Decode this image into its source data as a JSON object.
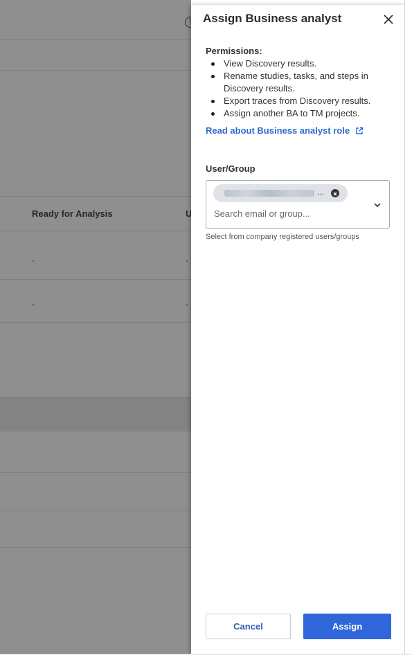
{
  "background": {
    "column_header": "Ready for Analysis",
    "column_header_cut": "U",
    "row_values": [
      "-",
      "-",
      "-",
      "-"
    ],
    "help_icon": "question-circle-icon"
  },
  "drawer": {
    "title": "Assign Business analyst",
    "close_icon": "close-icon",
    "permissions_title": "Permissions:",
    "permissions": [
      "View Discovery results.",
      "Rename studies, tasks, and steps in Discovery results.",
      "Export traces from Discovery results.",
      "Assign another BA to TM projects."
    ],
    "role_link": "Read about Business analyst role",
    "role_link_icon": "external-link-icon",
    "user_group": {
      "label": "User/Group",
      "chip_ellipsis": "...",
      "chip_remove_icon": "close-circle-icon",
      "search_placeholder": "Search email or group...",
      "search_value": "",
      "chevron_icon": "chevron-down-icon",
      "helper": "Select from company registered users/groups"
    },
    "buttons": {
      "cancel": "Cancel",
      "assign": "Assign"
    }
  },
  "colors": {
    "accent": "#2f66d9",
    "link": "#2f6ad4",
    "overlay": "#8f8f8f"
  }
}
